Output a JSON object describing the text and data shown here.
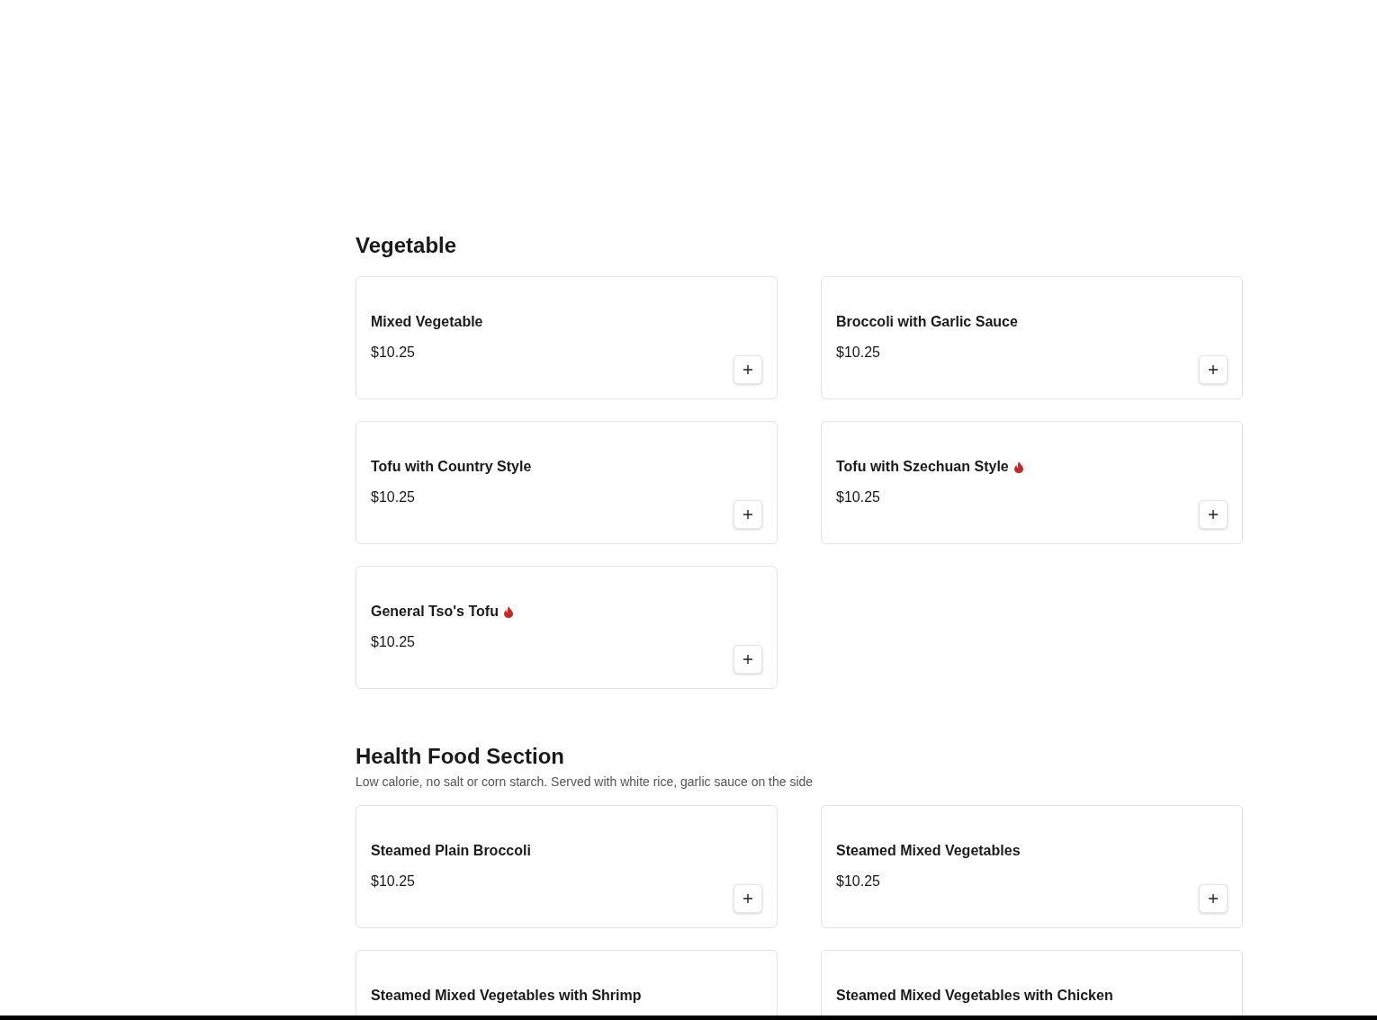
{
  "sections": [
    {
      "title": "Vegetable",
      "items": [
        {
          "name": "Mixed Vegetable",
          "spicy": false,
          "price": "$10.25"
        },
        {
          "name": "Broccoli with Garlic Sauce",
          "spicy": false,
          "price": "$10.25"
        },
        {
          "name": "Tofu with Country Style",
          "spicy": false,
          "price": "$10.25"
        },
        {
          "name": "Tofu with Szechuan Style",
          "spicy": true,
          "price": "$10.25"
        },
        {
          "name": "General Tso's Tofu",
          "spicy": true,
          "price": "$10.25"
        }
      ]
    },
    {
      "title": "Health Food Section",
      "description": "Low calorie, no salt or corn starch. Served with white rice, garlic sauce on the side",
      "items": [
        {
          "name": "Steamed Plain Broccoli",
          "spicy": false,
          "price": "$10.25"
        },
        {
          "name": "Steamed Mixed Vegetables",
          "spicy": false,
          "price": "$10.25"
        },
        {
          "name": "Steamed Mixed Vegetables with Shrimp",
          "spicy": false
        },
        {
          "name": "Steamed Mixed Vegetables with Chicken",
          "spicy": false
        }
      ]
    }
  ]
}
